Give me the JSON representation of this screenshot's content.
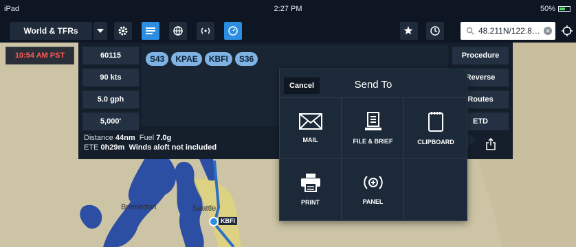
{
  "status_bar": {
    "device": "iPad",
    "time": "2:27 PM",
    "battery": "50%"
  },
  "toolbar": {
    "map_selector": "World & TFRs",
    "search_value": "48.211N/122.8…",
    "icons": [
      "gear-icon",
      "list-icon",
      "globe-icon",
      "radio-icon",
      "gauge-icon",
      "star-icon",
      "clock-icon",
      "search-icon",
      "crosshair-icon"
    ]
  },
  "time_chip": "10:54 AM PST",
  "flight_plan": {
    "fields": [
      "60115",
      "90 kts",
      "5.0 gph",
      "5,000'"
    ],
    "route": [
      "S43",
      "KPAE",
      "KBFI",
      "S36"
    ],
    "actions": [
      "Procedure",
      "Reverse",
      "Routes",
      "ETD"
    ],
    "distance_label": "Distance",
    "distance": "44nm",
    "fuel_label": "Fuel",
    "fuel": "7.0g",
    "ete_label": "ETE",
    "ete": "0h29m",
    "winds_note": "Winds aloft not included"
  },
  "popover": {
    "cancel": "Cancel",
    "title": "Send To",
    "options": [
      {
        "label": "MAIL",
        "icon": "mail-icon"
      },
      {
        "label": "FILE & BRIEF",
        "icon": "file-brief-icon"
      },
      {
        "label": "CLIPBOARD",
        "icon": "clipboard-icon"
      },
      {
        "label": "PRINT",
        "icon": "print-icon"
      },
      {
        "label": "PANEL",
        "icon": "panel-icon"
      }
    ]
  },
  "map": {
    "labels": [
      "Bremerton",
      "Seattle"
    ],
    "airport": "KBFI"
  }
}
